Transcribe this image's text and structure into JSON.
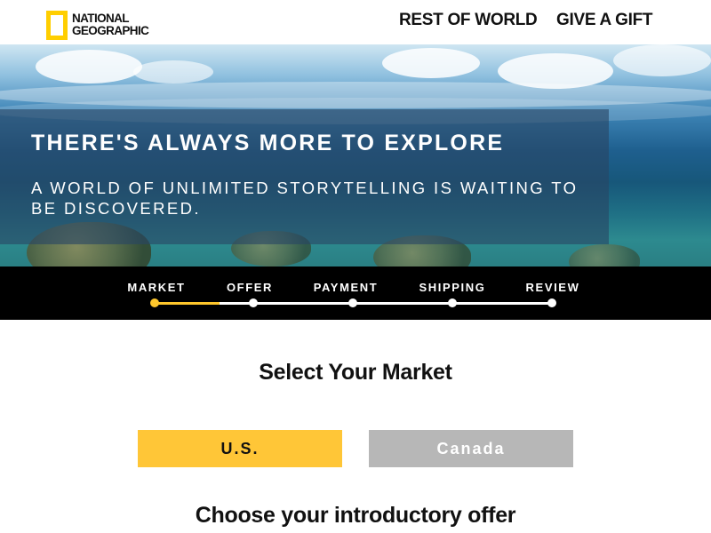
{
  "header": {
    "logo_line1": "NATIONAL",
    "logo_line2": "GEOGRAPHIC",
    "nav": [
      {
        "label": "REST OF WORLD"
      },
      {
        "label": "GIVE A GIFT"
      }
    ]
  },
  "hero": {
    "title": "THERE'S ALWAYS MORE TO EXPLORE",
    "subtitle": "A WORLD OF UNLIMITED STORYTELLING IS WAITING TO BE DISCOVERED."
  },
  "steps": {
    "items": [
      {
        "label": "MARKET"
      },
      {
        "label": "OFFER"
      },
      {
        "label": "PAYMENT"
      },
      {
        "label": "SHIPPING"
      },
      {
        "label": "REVIEW"
      }
    ],
    "active_index": 0
  },
  "main": {
    "select_title": "Select Your Market",
    "markets": [
      {
        "label": "U.S."
      },
      {
        "label": "Canada"
      }
    ],
    "selected_market": "U.S.",
    "offer_title": "Choose your introductory offer"
  },
  "colors": {
    "brand_yellow": "#FFCE00",
    "selected_button": "#FFC637",
    "unselected_button": "#B7B7B7",
    "progress_active": "#FFC72C",
    "steps_bar": "#000000"
  },
  "icons": [
    "national-geographic-logo",
    "progress-dot"
  ]
}
